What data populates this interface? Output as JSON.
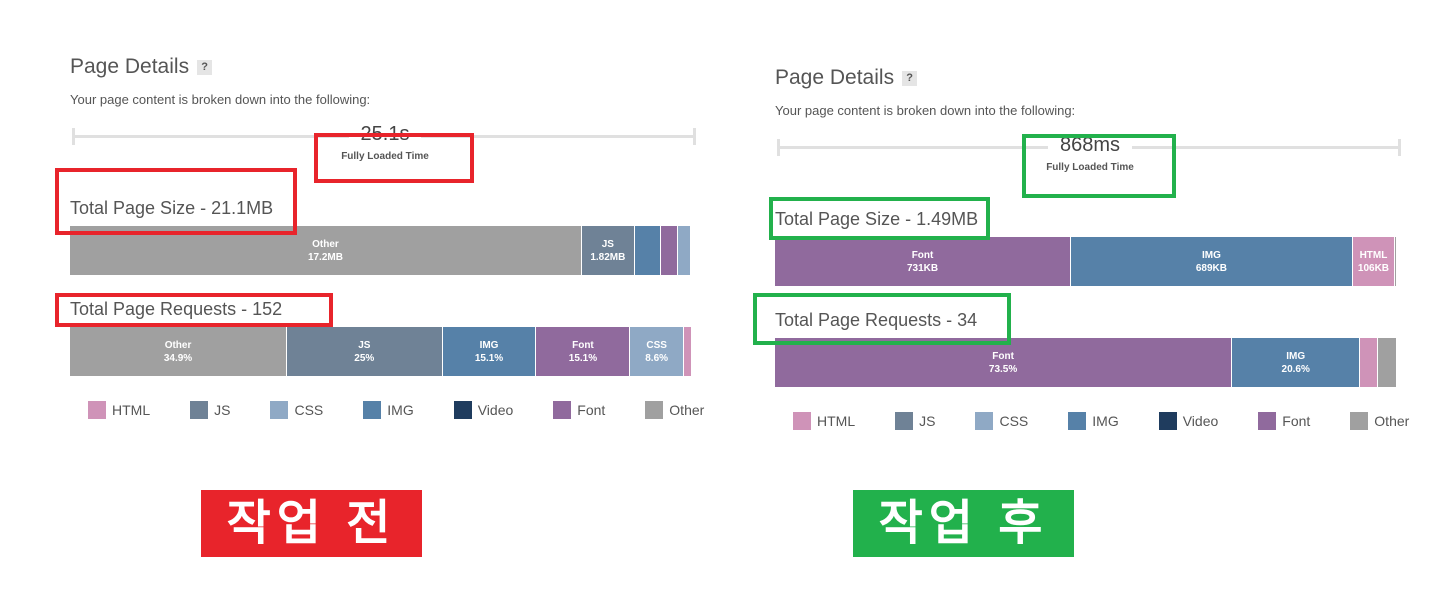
{
  "colors": {
    "HTML": "#cf93b8",
    "JS": "#6f8296",
    "CSS": "#8fa9c5",
    "IMG": "#5681a8",
    "Video": "#1f3c5e",
    "Font": "#906a9d",
    "Other": "#a0a0a0",
    "before_accent": "#e8242b",
    "after_accent": "#22b14c"
  },
  "panels": [
    {
      "title": "Page Details",
      "help": "?",
      "subtitle": "Your page content is broken down into the following:",
      "time_value": "25.1s",
      "time_label": "Fully Loaded Time",
      "size_title": "Total Page Size - 21.1MB",
      "size_segments": [
        {
          "type": "Other",
          "share": 82.3,
          "label": "Other",
          "value": "17.2MB"
        },
        {
          "type": "JS",
          "share": 8.5,
          "label": "JS",
          "value": "1.82MB"
        },
        {
          "type": "IMG",
          "share": 4.3
        },
        {
          "type": "Font",
          "share": 2.6
        },
        {
          "type": "CSS",
          "share": 2.1
        },
        {
          "type": "HTML",
          "share": 0.2
        }
      ],
      "req_title": "Total Page Requests - 152",
      "req_segments": [
        {
          "type": "Other",
          "share": 34.9,
          "label": "Other",
          "value": "34.9%"
        },
        {
          "type": "JS",
          "share": 25,
          "label": "JS",
          "value": "25%"
        },
        {
          "type": "IMG",
          "share": 15.1,
          "label": "IMG",
          "value": "15.1%"
        },
        {
          "type": "Font",
          "share": 15.1,
          "label": "Font",
          "value": "15.1%"
        },
        {
          "type": "CSS",
          "share": 8.6,
          "label": "CSS",
          "value": "8.6%"
        },
        {
          "type": "HTML",
          "share": 1.3
        }
      ],
      "badge": "작업 전"
    },
    {
      "title": "Page Details",
      "help": "?",
      "subtitle": "Your page content is broken down into the following:",
      "time_value": "868ms",
      "time_label": "Fully Loaded Time",
      "size_title": "Total Page Size - 1.49MB",
      "size_segments": [
        {
          "type": "Font",
          "share": 47.6,
          "label": "Font",
          "value": "731KB"
        },
        {
          "type": "IMG",
          "share": 45.3,
          "label": "IMG",
          "value": "689KB"
        },
        {
          "type": "HTML",
          "share": 6.8,
          "label": "HTML",
          "value": "106KB"
        },
        {
          "type": "Other",
          "share": 0.3
        }
      ],
      "req_title": "Total Page Requests - 34",
      "req_segments": [
        {
          "type": "Font",
          "share": 73.5,
          "label": "Font",
          "value": "73.5%"
        },
        {
          "type": "IMG",
          "share": 20.6,
          "label": "IMG",
          "value": "20.6%"
        },
        {
          "type": "HTML",
          "share": 2.9
        },
        {
          "type": "Other",
          "share": 3.0
        }
      ],
      "badge": "작업 후"
    }
  ],
  "legend": [
    "HTML",
    "JS",
    "CSS",
    "IMG",
    "Video",
    "Font",
    "Other"
  ]
}
